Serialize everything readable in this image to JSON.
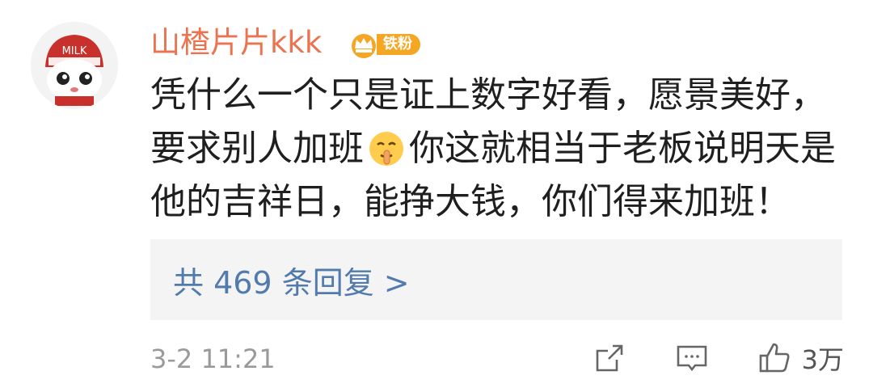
{
  "comment": {
    "username": "山楂片片kkk",
    "avatar_text": "MILK",
    "badge": {
      "label": "铁粉",
      "icon": "crown-badge-icon",
      "color": "#f5a623"
    },
    "text_lines": [
      "凭什么一个只是证上数字好看，愿景美好，",
      [
        "要求别人加班",
        "你这就相当于老板说明天是"
      ],
      "他的吉祥日，能挣大钱，你们得来加班！"
    ],
    "emoji": "shushing-face-emoji",
    "replies_label": "共 469 条回复 >",
    "timestamp": "3-2 11:21",
    "actions": {
      "share_icon": "share-icon",
      "comment_icon": "comment-icon",
      "like_icon": "thumbs-up-icon",
      "like_count": "3万"
    }
  },
  "colors": {
    "username": "#eb7350",
    "link": "#527bad",
    "muted": "#9a9a9a"
  }
}
